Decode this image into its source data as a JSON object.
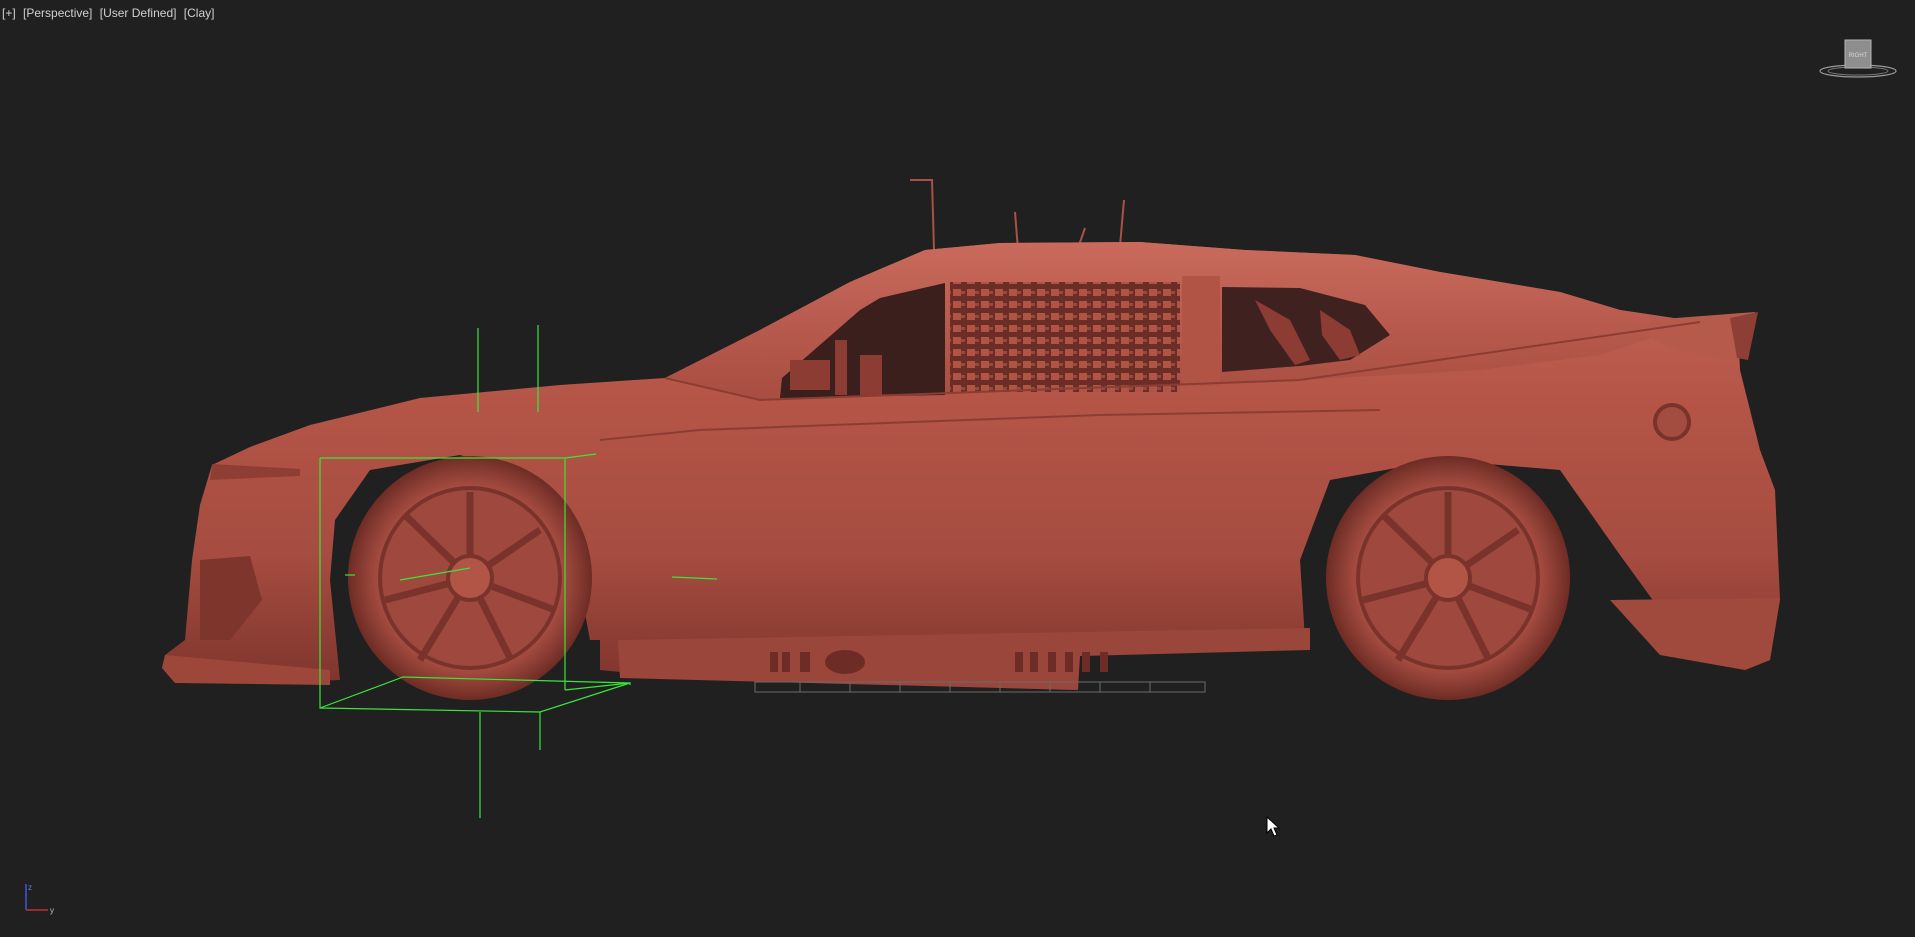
{
  "viewport": {
    "labels": {
      "menu": "[+]",
      "view": "[Perspective]",
      "camera": "[User Defined]",
      "shading": "[Clay]"
    },
    "viewcube": {
      "face_label": "RIGHT",
      "icon": "viewcube-icon"
    },
    "axis_tripod": {
      "z_label": "z",
      "y_label": "y",
      "icon": "axis-tripod-icon"
    },
    "colors": {
      "background": "#202020",
      "clay_body": "#b5574a",
      "clay_dark": "#7d342b",
      "clay_light": "#c9685a",
      "selection_gizmo": "#39e639",
      "label_text": "#d0d0d0"
    }
  },
  "scene": {
    "object": "race-car-model",
    "selected_part": "front-wheel",
    "cursor_icon": "mouse-pointer-icon"
  }
}
